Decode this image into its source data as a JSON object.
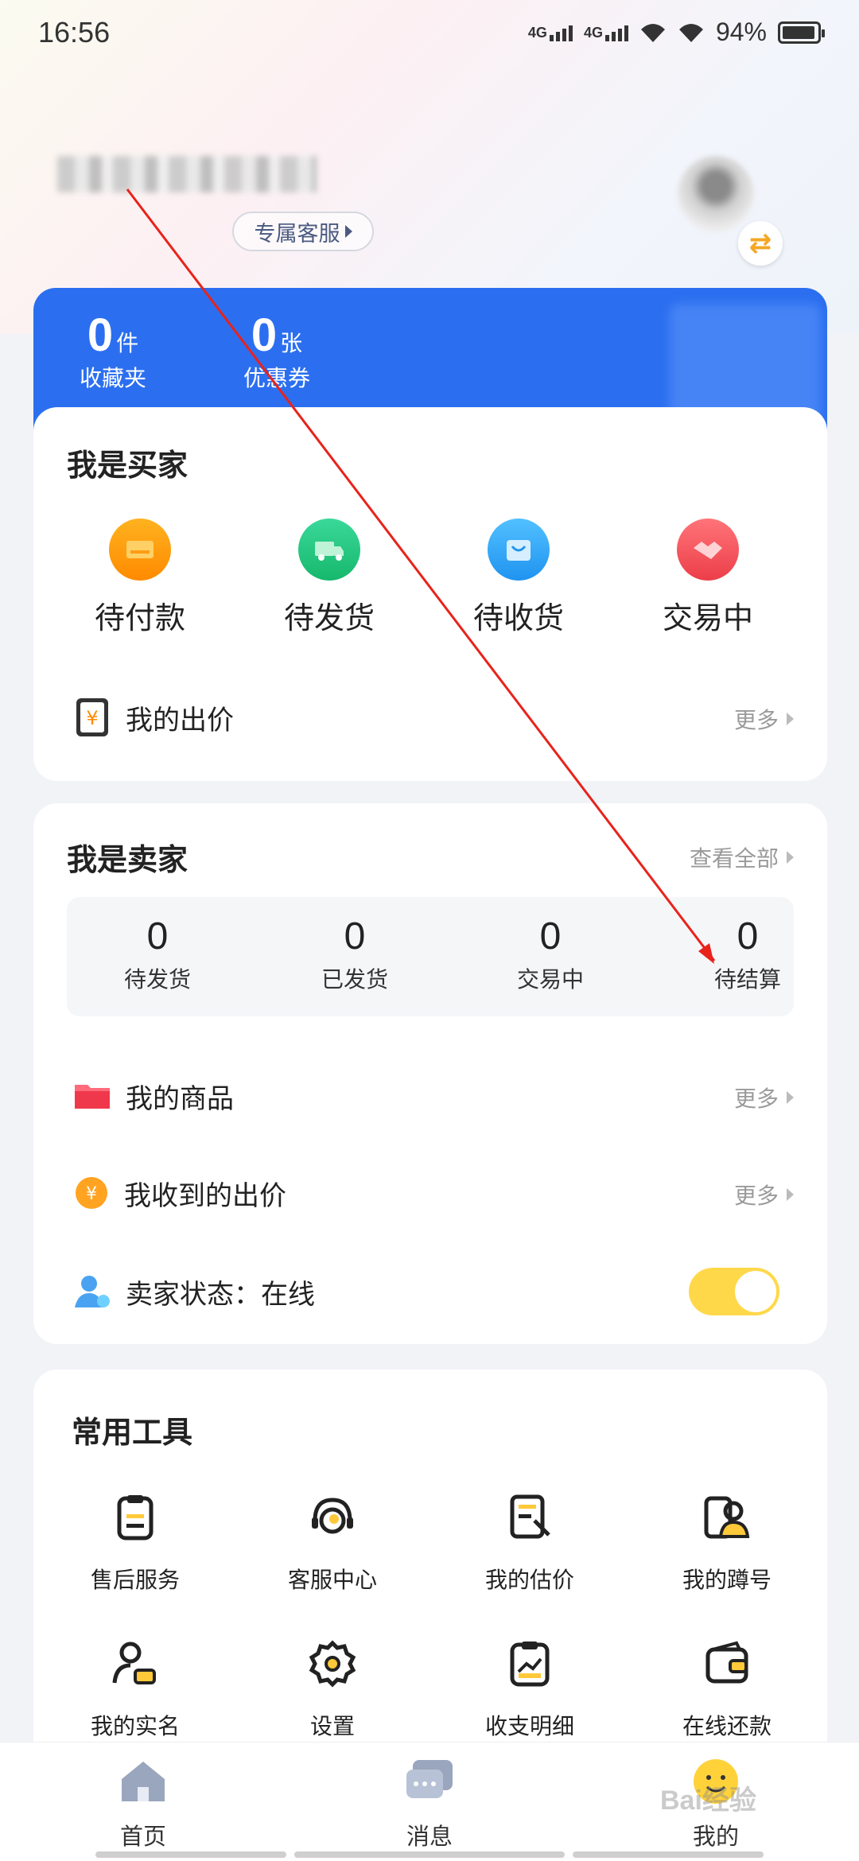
{
  "status_bar": {
    "time": "16:56",
    "net1": "4G",
    "net2": "4G",
    "battery": "94%"
  },
  "profile": {
    "service_label": "专属客服"
  },
  "stats": [
    {
      "num": "0",
      "unit": "件",
      "label": "收藏夹"
    },
    {
      "num": "0",
      "unit": "张",
      "label": "优惠券"
    }
  ],
  "buyer": {
    "title": "我是买家",
    "items": [
      {
        "label": "待付款",
        "icon": "wallet-icon",
        "color": "#ff9d14"
      },
      {
        "label": "待发货",
        "icon": "truck-icon",
        "color": "#22c47e"
      },
      {
        "label": "待收货",
        "icon": "bag-icon",
        "color": "#2aa8f5"
      },
      {
        "label": "交易中",
        "icon": "handshake-icon",
        "color": "#f2545b"
      }
    ],
    "my_bids": "我的出价",
    "more": "更多"
  },
  "seller": {
    "title": "我是卖家",
    "view_all": "查看全部",
    "stats": [
      {
        "num": "0",
        "label": "待发货"
      },
      {
        "num": "0",
        "label": "已发货"
      },
      {
        "num": "0",
        "label": "交易中"
      },
      {
        "num": "0",
        "label": "待结算"
      }
    ],
    "my_goods": "我的商品",
    "received_bids": "我收到的出价",
    "status_label": "卖家状态：在线",
    "status_online": true,
    "more": "更多"
  },
  "tools": {
    "title": "常用工具",
    "items": [
      {
        "label": "售后服务",
        "icon": "clipboard-icon"
      },
      {
        "label": "客服中心",
        "icon": "headset-icon"
      },
      {
        "label": "我的估价",
        "icon": "appraisal-icon"
      },
      {
        "label": "我的蹲号",
        "icon": "account-watch-icon"
      },
      {
        "label": "我的实名",
        "icon": "user-id-icon"
      },
      {
        "label": "设置",
        "icon": "gear-icon"
      },
      {
        "label": "收支明细",
        "icon": "chart-clipboard-icon"
      },
      {
        "label": "在线还款",
        "icon": "wallet-icon"
      }
    ]
  },
  "nav": [
    {
      "label": "首页",
      "icon": "home-icon"
    },
    {
      "label": "消息",
      "icon": "message-icon"
    },
    {
      "label": "我的",
      "icon": "profile-smile-icon"
    }
  ],
  "watermark": "Bai经验"
}
